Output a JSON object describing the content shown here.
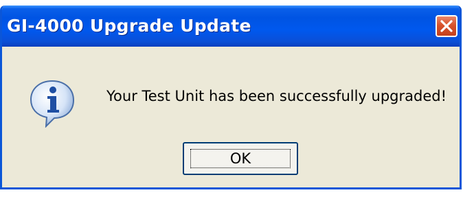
{
  "window": {
    "title": "GI-4000 Upgrade Update",
    "accent_color": "#0054e3",
    "body_color": "#ece9d8"
  },
  "close_button": {
    "icon": "close-icon",
    "color": "#d9532c"
  },
  "dialog": {
    "icon": "information-icon",
    "icon_glyph": "i",
    "message": "Your Test Unit has been successfully upgraded!"
  },
  "buttons": {
    "ok_label": "OK"
  }
}
